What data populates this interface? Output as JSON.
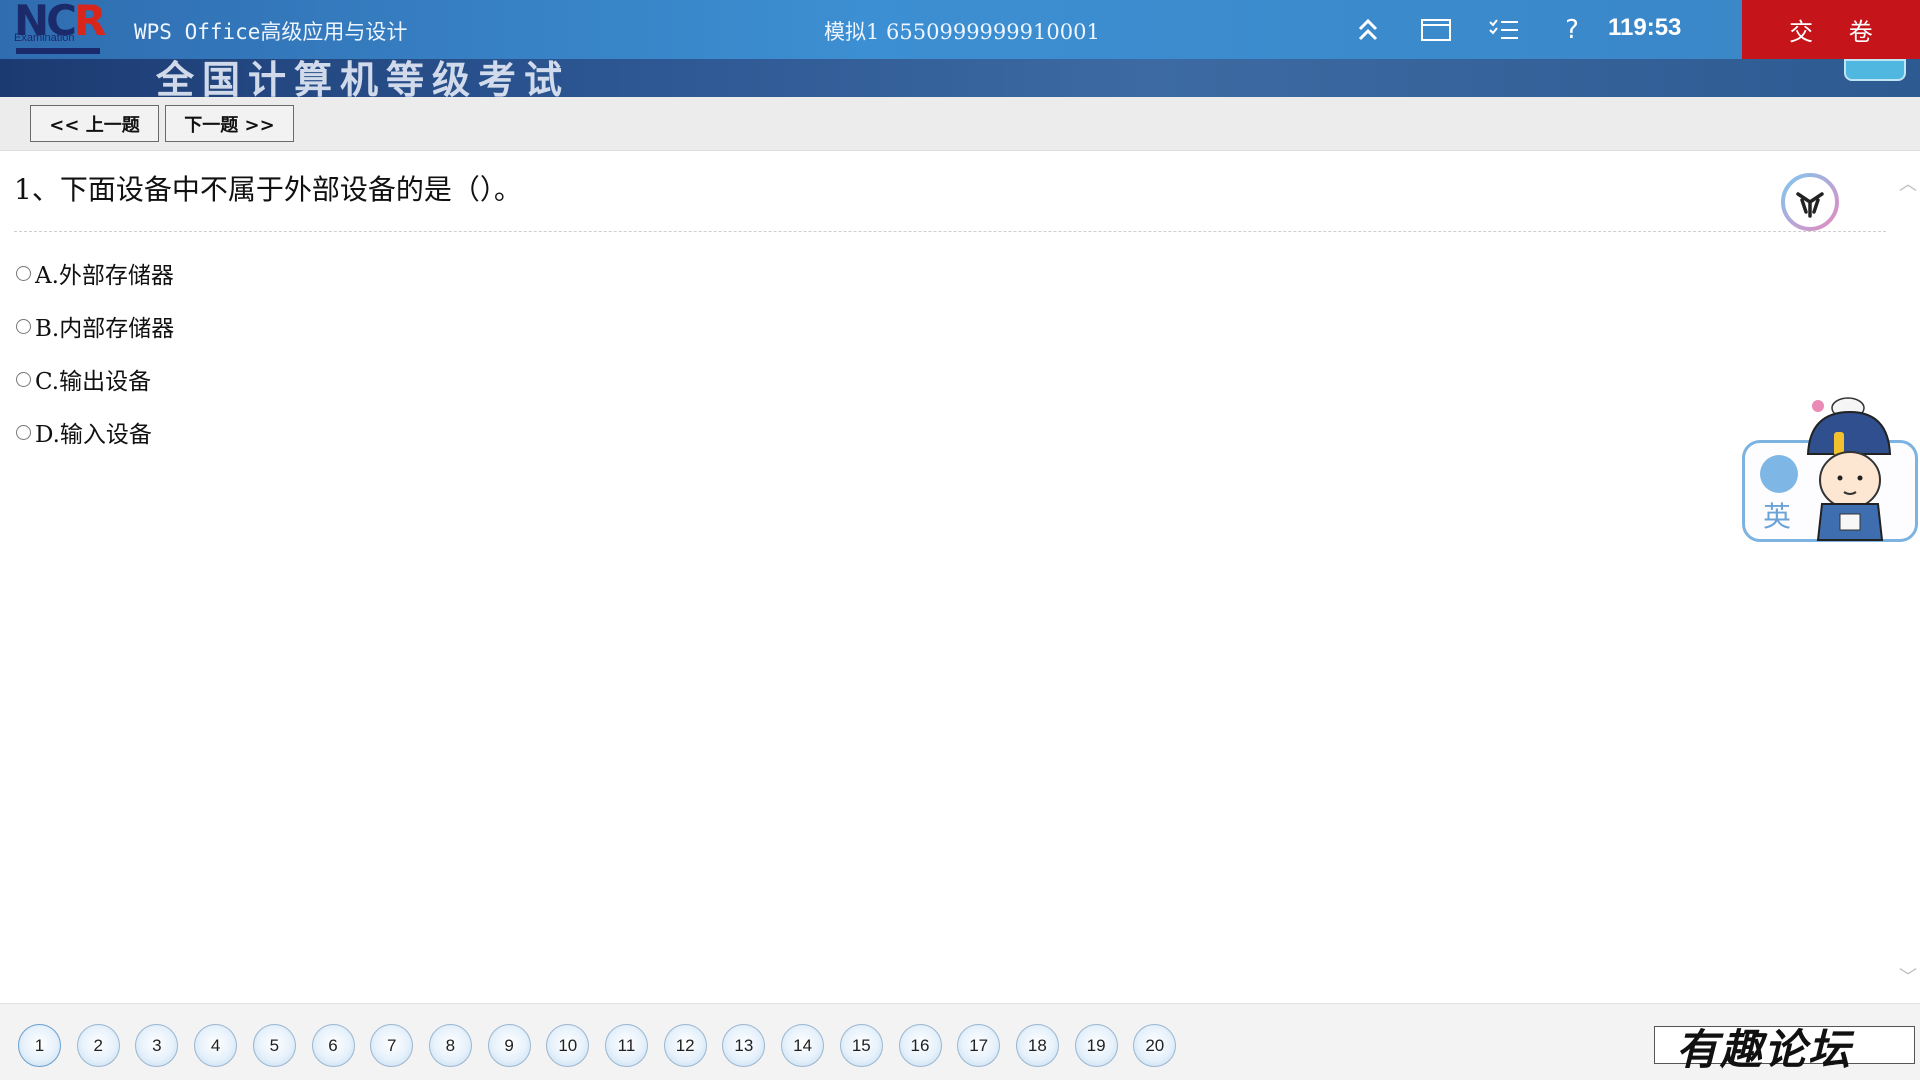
{
  "titlebar": {
    "logo_text": "NCR",
    "logo_sub": "Examination",
    "app_title": "WPS Office高级应用与设计",
    "exam_info": "模拟1  6550999999910001",
    "timer": "119:53",
    "submit_label": "交 卷",
    "icons": [
      "collapse-up-icon",
      "window-icon",
      "checklist-icon",
      "help-icon"
    ],
    "help_glyph": "?"
  },
  "banner": {
    "text": "全国计算机等级考试"
  },
  "toolbar": {
    "prev_label": "<< 上一题",
    "next_label": "下一题 >>"
  },
  "question": {
    "text": "1、下面设备中不属于外部设备的是（）。",
    "options": [
      {
        "label": "A.外部存储器"
      },
      {
        "label": "B.内部存储器"
      },
      {
        "label": "C.输出设备"
      },
      {
        "label": "D.输入设备"
      }
    ]
  },
  "ime_widget": {
    "lang": "英"
  },
  "bottom_nav": {
    "numbers": [
      "1",
      "2",
      "3",
      "4",
      "5",
      "6",
      "7",
      "8",
      "9",
      "10",
      "11",
      "12",
      "13",
      "14",
      "15",
      "16",
      "17",
      "18",
      "19",
      "20"
    ],
    "watermark": "有趣论坛"
  },
  "colors": {
    "titlebar": "#3c8fd2",
    "submit": "#c5141a",
    "banner": "#2b5591"
  }
}
